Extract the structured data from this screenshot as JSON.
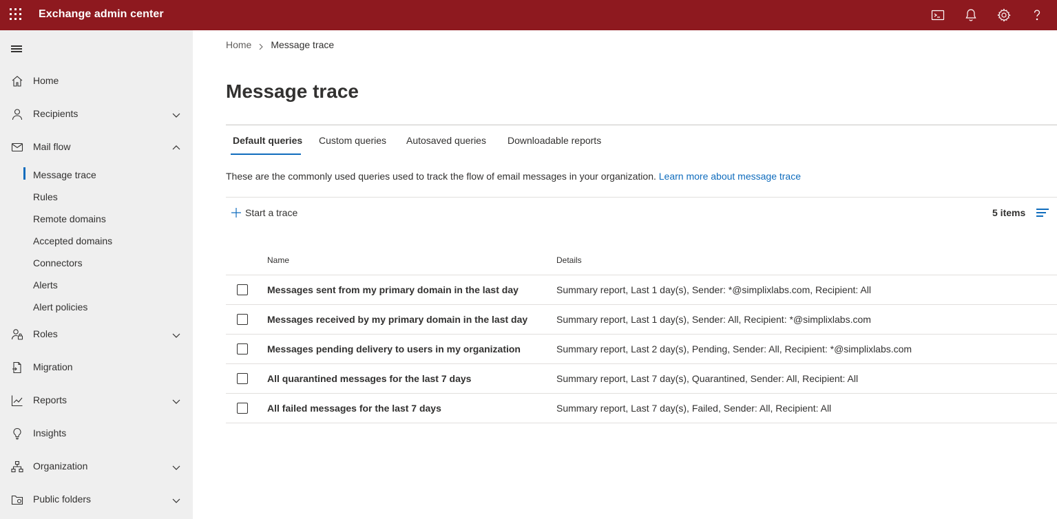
{
  "app": {
    "title": "Exchange admin center"
  },
  "topbar_icons": [
    "cloud-shell-icon",
    "notifications-bell-icon",
    "settings-gear-icon",
    "help-icon"
  ],
  "sidebar": {
    "items": [
      {
        "label": "Home",
        "icon": "home-icon"
      },
      {
        "label": "Recipients",
        "icon": "person-icon"
      },
      {
        "label": "Mail flow",
        "icon": "mail-icon"
      },
      {
        "label": "Roles",
        "icon": "roles-icon"
      },
      {
        "label": "Migration",
        "icon": "migration-icon"
      },
      {
        "label": "Reports",
        "icon": "chart-icon"
      },
      {
        "label": "Insights",
        "icon": "lightbulb-icon"
      },
      {
        "label": "Organization",
        "icon": "org-icon"
      },
      {
        "label": "Public folders",
        "icon": "folder-icon"
      }
    ],
    "mail_flow_subitems": [
      {
        "label": "Message trace",
        "active": true
      },
      {
        "label": "Rules"
      },
      {
        "label": "Remote domains"
      },
      {
        "label": "Accepted domains"
      },
      {
        "label": "Connectors"
      },
      {
        "label": "Alerts"
      },
      {
        "label": "Alert policies"
      }
    ]
  },
  "breadcrumb": {
    "home": "Home",
    "current": "Message trace"
  },
  "page": {
    "title": "Message trace",
    "description": "These are the commonly used queries used to track the flow of email messages in your organization.",
    "learn_more": "Learn more about message trace"
  },
  "tabs": [
    {
      "label": "Default queries",
      "active": true
    },
    {
      "label": "Custom queries"
    },
    {
      "label": "Autosaved queries"
    },
    {
      "label": "Downloadable reports"
    }
  ],
  "toolbar": {
    "start_trace": "Start a trace",
    "items_count": "5 items"
  },
  "table": {
    "columns": [
      "Name",
      "Details"
    ],
    "rows": [
      {
        "name": "Messages sent from my primary domain in the last day",
        "details": "Summary report, Last 1 day(s), Sender: *@simplixlabs.com, Recipient: All"
      },
      {
        "name": "Messages received by my primary domain in the last day",
        "details": "Summary report, Last 1 day(s), Sender: All, Recipient: *@simplixlabs.com"
      },
      {
        "name": "Messages pending delivery to users in my organization",
        "details": "Summary report, Last 2 day(s), Pending, Sender: All, Recipient: *@simplixlabs.com"
      },
      {
        "name": "All quarantined messages for the last 7 days",
        "details": "Summary report, Last 7 day(s), Quarantined, Sender: All, Recipient: All"
      },
      {
        "name": "All failed messages for the last 7 days",
        "details": "Summary report, Last 7 day(s), Failed, Sender: All, Recipient: All"
      }
    ]
  },
  "colors": {
    "topbar": "#8e191f",
    "sidebar": "#efefef",
    "accent": "#0f6cbd",
    "text": "#323130"
  }
}
